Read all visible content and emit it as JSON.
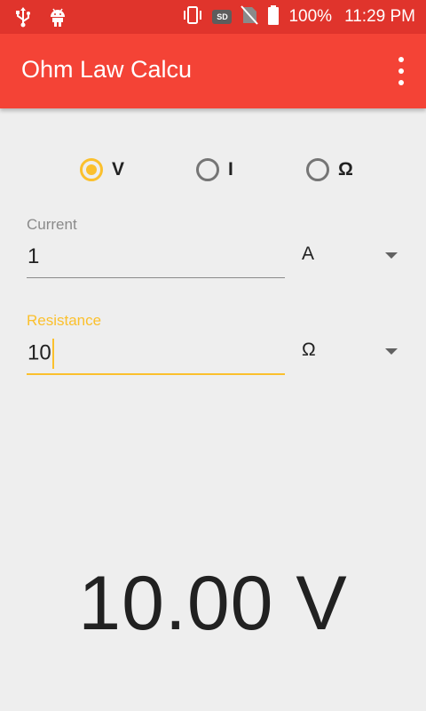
{
  "status_bar": {
    "battery": "100%",
    "time": "11:29 PM",
    "icons": [
      "usb-icon",
      "android-icon",
      "vibrate-icon",
      "sd-card-icon",
      "no-sim-icon",
      "battery-icon"
    ],
    "sd_label": "SD"
  },
  "app_bar": {
    "title": "Ohm Law Calcu",
    "background": "#f44336",
    "overflow_icon": "more-vert-icon"
  },
  "radio_options": {
    "voltage": "V",
    "current": "I",
    "resistance": "Ω",
    "selected": "V"
  },
  "fields": {
    "current": {
      "label": "Current",
      "value": "1",
      "unit": "A"
    },
    "resistance": {
      "label": "Resistance",
      "value": "10",
      "unit": "Ω"
    }
  },
  "result": "10.00 V",
  "colors": {
    "accent": "#fbc02d",
    "primary": "#f44336",
    "status_bar": "#e0342c"
  }
}
